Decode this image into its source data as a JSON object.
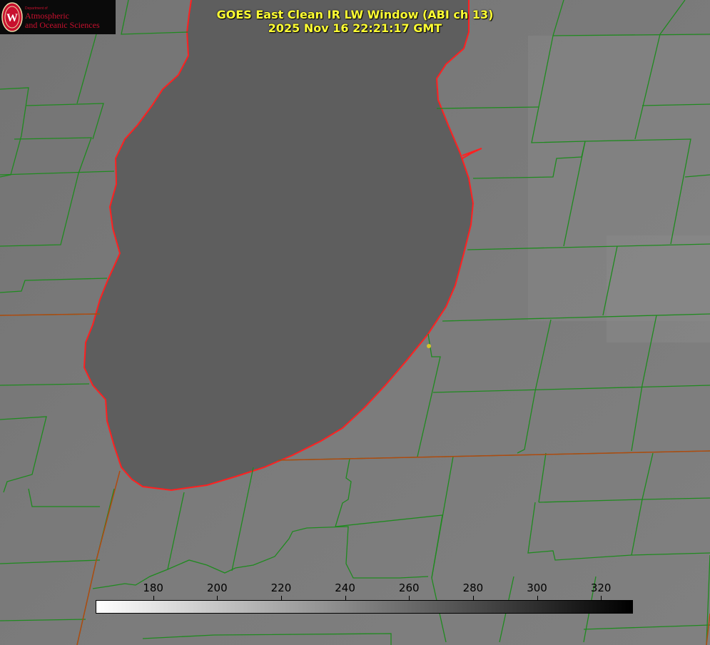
{
  "title": {
    "line1": "GOES East Clean IR LW Window (ABI ch 13)",
    "line2": "2025 Nov 16 22:21:17 GMT"
  },
  "logo": {
    "department": "Department of",
    "line1": "Atmospheric",
    "line2": "and Oceanic Sciences",
    "seal_letter": "W",
    "color": "#c8102e"
  },
  "colorbar": {
    "ticks": [
      "180",
      "200",
      "220",
      "240",
      "260",
      "280",
      "300",
      "320"
    ],
    "tick_values": [
      180,
      200,
      220,
      240,
      260,
      280,
      300,
      320
    ],
    "range": [
      162,
      330
    ],
    "color_low": "#ffffff",
    "color_high": "#000000"
  },
  "colors": {
    "title": "#ffff33",
    "lake_fill": "#5e5e5e",
    "land_fill": "#7a7a7a",
    "county_lines": "#1f8a1f",
    "shoreline": "#ff2020",
    "marker": "#d4c32a"
  },
  "icons": [
    "uw-seal-icon",
    "location-marker-icon"
  ]
}
